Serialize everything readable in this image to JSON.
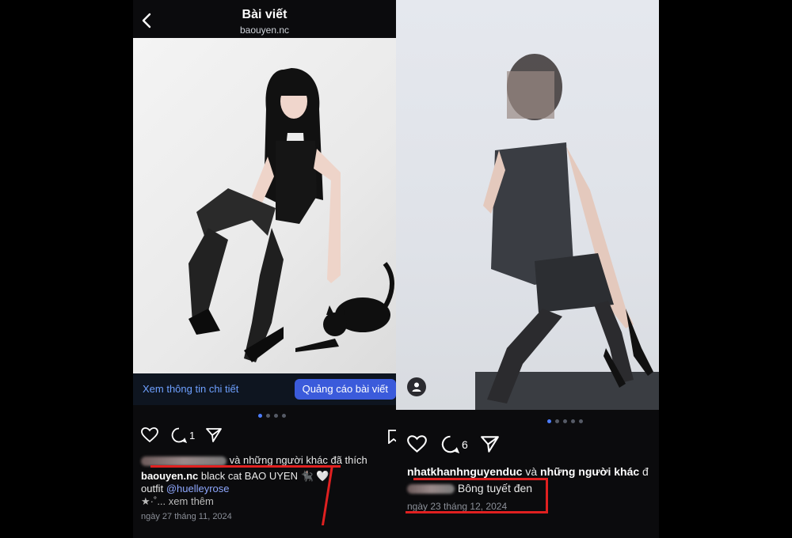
{
  "left_post": {
    "header": {
      "title": "Bài viết",
      "username": "baouyen.nc"
    },
    "cta": {
      "details_link": "Xem thông tin chi tiết",
      "promote_button": "Quảng cáo bài viết"
    },
    "comment_count": "1",
    "likes": {
      "suffix": "và những người khác đã thích"
    },
    "caption": {
      "username": "baouyen.nc",
      "text": "black cat BAO UYEN 🐈‍⬛ 🤍",
      "outfit_label": "outfit",
      "mention": "@huelleyrose",
      "more_prefix": "★·˚...",
      "more_link": "xem thêm"
    },
    "date": "ngày 27 tháng 11, 2024"
  },
  "right_post": {
    "comment_count": "6",
    "likes": {
      "username": "nhatkhanhnguyenduc",
      "middle": "và",
      "others": "những người khác",
      "tail": "đ"
    },
    "caption": {
      "text": "Bông tuyết đen"
    },
    "date": "ngày 23 tháng 12, 2024"
  },
  "colors": {
    "accent": "#4c7dff",
    "highlight": "#e02020",
    "button": "#3b5bdb"
  }
}
